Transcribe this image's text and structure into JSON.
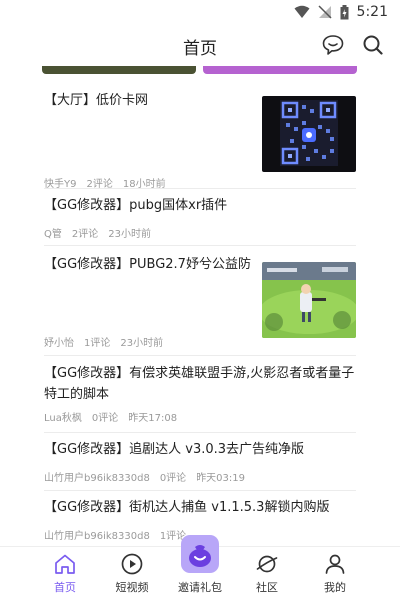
{
  "status": {
    "time": "5:21"
  },
  "header": {
    "title": "首页"
  },
  "colors": {
    "accent": "#7a5cf0",
    "banner_left": "#4a5233",
    "banner_right": "#b562d0"
  },
  "posts": [
    {
      "title": "【大厅】低价卡网",
      "author": "快手Y9",
      "comments": "2评论",
      "time": "18小时前",
      "image": "qr-code"
    },
    {
      "title": "【GG修改器】pubg国体xr插件",
      "author": "Q管",
      "comments": "2评论",
      "time": "23小时前"
    },
    {
      "title": "【GG修改器】PUBG2.7妤兮公益防",
      "author": "妤小怡",
      "comments": "1评论",
      "time": "23小时前",
      "image": "game-screenshot"
    },
    {
      "title": "【GG修改器】有偿求英雄联盟手游,火影忍者或者量子特工的脚本",
      "author": "Lua秋枫",
      "comments": "0评论",
      "time": "昨天17:08"
    },
    {
      "title": "【GG修改器】追剧达人 v3.0.3去广告纯净版",
      "author": "山竹用户b96ik8330d8",
      "comments": "0评论",
      "time": "昨天03:19"
    },
    {
      "title": "【GG修改器】街机达人捕鱼 v1.1.5.3解锁内购版",
      "author": "山竹用户b96ik8330d8",
      "comments": "1评论",
      "time": ""
    }
  ],
  "tabs": [
    {
      "label": "首页",
      "icon": "home-icon"
    },
    {
      "label": "短视频",
      "icon": "play-circle-icon"
    },
    {
      "label": "邀请礼包",
      "icon": "gift-bag-icon"
    },
    {
      "label": "社区",
      "icon": "planet-icon"
    },
    {
      "label": "我的",
      "icon": "person-icon"
    }
  ]
}
